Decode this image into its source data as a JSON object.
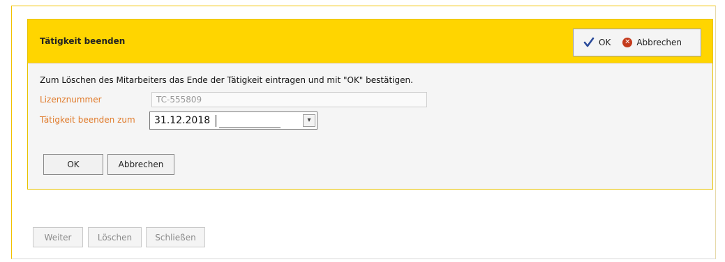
{
  "dialog": {
    "title": "Tätigkeit beenden",
    "header_ok": "OK",
    "header_cancel": "Abbrechen",
    "cancel_icon_glyph": "✕",
    "instruction": "Zum Löschen des Mitarbeiters das Ende der Tätigkeit eintragen und mit \"OK\" bestätigen.",
    "license_label": "Lizenznummer",
    "license_value": "TC-555809",
    "end_label": "Tätigkeit beenden zum",
    "end_value": "31.12.2018",
    "dropdown_glyph": "▾",
    "ok_button": "OK",
    "cancel_button": "Abbrechen"
  },
  "footer": {
    "weiter": "Weiter",
    "loeschen": "Löschen",
    "schliessen": "Schließen"
  },
  "colors": {
    "header_bg": "#ffd500",
    "label_orange": "#e07a2a",
    "check_blue": "#2a4a9a",
    "cancel_red": "#c43a1c"
  },
  "icons": [
    "check-icon",
    "cancel-icon",
    "chevron-down-icon"
  ]
}
